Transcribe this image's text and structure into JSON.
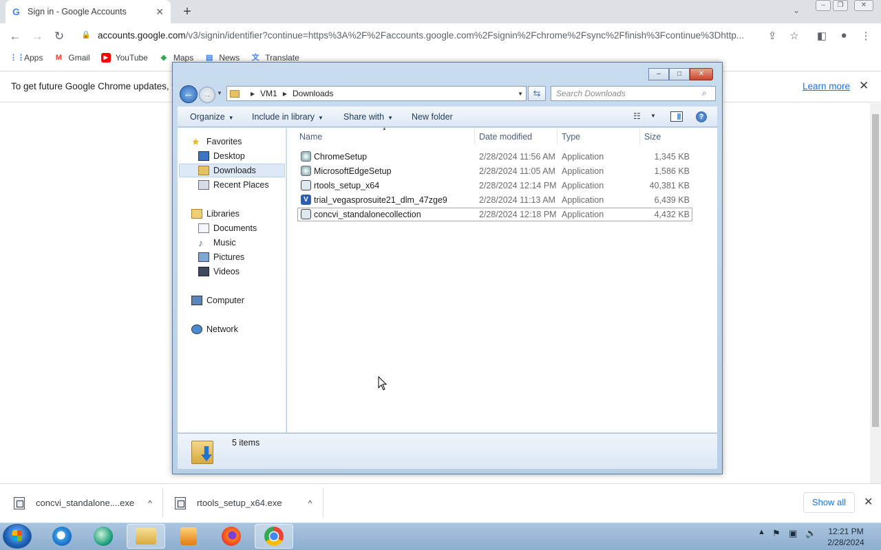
{
  "browser": {
    "tab_title": "Sign in - Google Accounts",
    "url_domain": "accounts.google.com",
    "url_rest": "/v3/signin/identifier?continue=https%3A%2F%2Faccounts.google.com%2Fsignin%2Fchrome%2Fsync%2Ffinish%3Fcontinue%3Dhttp...",
    "bookmarks": [
      {
        "label": "Apps",
        "icon": "apps-grid-icon"
      },
      {
        "label": "Gmail",
        "icon": "gmail-icon"
      },
      {
        "label": "YouTube",
        "icon": "youtube-icon"
      },
      {
        "label": "Maps",
        "icon": "maps-icon"
      },
      {
        "label": "News",
        "icon": "news-icon"
      },
      {
        "label": "Translate",
        "icon": "translate-icon"
      }
    ],
    "infobar": {
      "text": "To get future Google Chrome updates, yo",
      "link": "Learn more"
    },
    "downloads": [
      {
        "name": "concvi_standalone....exe"
      },
      {
        "name": "rtools_setup_x64.exe"
      }
    ],
    "show_all": "Show all"
  },
  "explorer": {
    "breadcrumb": [
      "VM1",
      "Downloads"
    ],
    "search_placeholder": "Search Downloads",
    "commands": {
      "organize": "Organize",
      "include": "Include in library",
      "share": "Share with",
      "new_folder": "New folder"
    },
    "nav": {
      "favorites": "Favorites",
      "desktop": "Desktop",
      "downloads": "Downloads",
      "recent": "Recent Places",
      "libraries": "Libraries",
      "documents": "Documents",
      "music": "Music",
      "pictures": "Pictures",
      "videos": "Videos",
      "computer": "Computer",
      "network": "Network"
    },
    "columns": {
      "name": "Name",
      "date": "Date modified",
      "type": "Type",
      "size": "Size"
    },
    "files": [
      {
        "name": "ChromeSetup",
        "date": "2/28/2024 11:56 AM",
        "type": "Application",
        "size": "1,345 KB",
        "icon": "installer-icon"
      },
      {
        "name": "MicrosoftEdgeSetup",
        "date": "2/28/2024 11:05 AM",
        "type": "Application",
        "size": "1,586 KB",
        "icon": "installer-icon"
      },
      {
        "name": "rtools_setup_x64",
        "date": "2/28/2024 12:14 PM",
        "type": "Application",
        "size": "40,381 KB",
        "icon": "setup-icon"
      },
      {
        "name": "trial_vegasprosuite21_dlm_47zge9",
        "date": "2/28/2024 11:13 AM",
        "type": "Application",
        "size": "6,439 KB",
        "icon": "vegas-icon"
      },
      {
        "name": "concvi_standalonecollection",
        "date": "2/28/2024 12:18 PM",
        "type": "Application",
        "size": "4,432 KB",
        "icon": "setup-icon"
      }
    ],
    "item_count": "5 items"
  },
  "taskbar": {
    "time": "12:21 PM",
    "date": "2/28/2024"
  }
}
